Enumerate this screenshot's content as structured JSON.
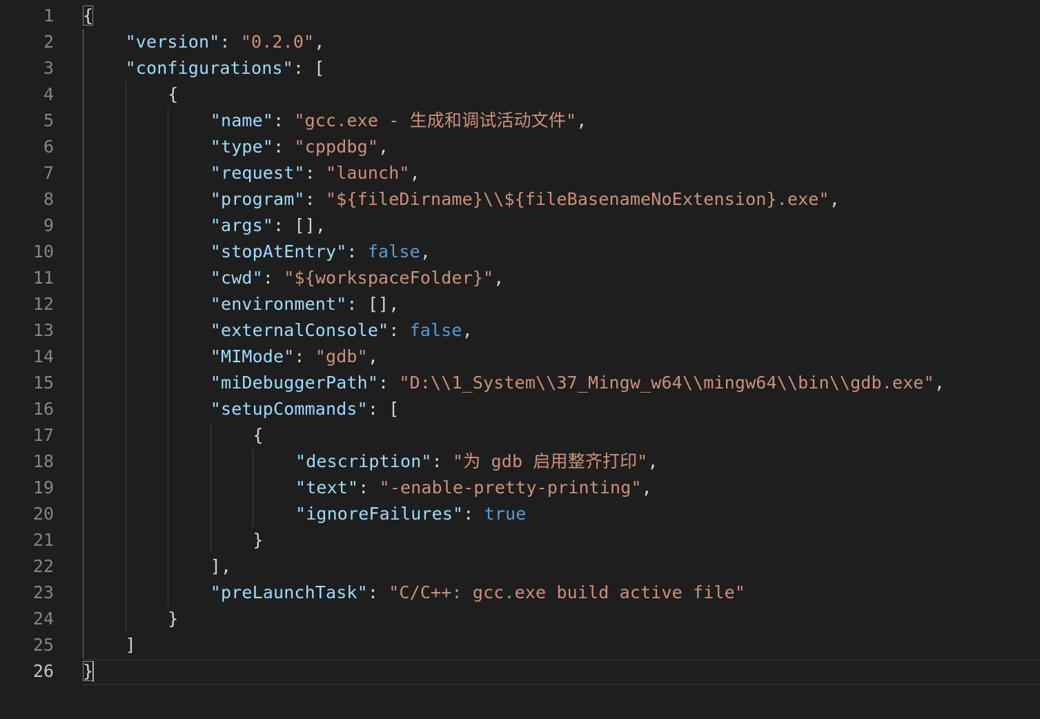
{
  "editor": {
    "active_line": 26,
    "theme": {
      "background": "#1e1e1e",
      "key_color": "#9cdcfe",
      "string_color": "#ce9178",
      "keyword_color": "#569cd6",
      "punctuation_color": "#d4d4d4",
      "line_number_color": "#858585"
    },
    "lines": [
      {
        "n": "1",
        "indent": 0,
        "tokens": [
          {
            "t": "pun",
            "v": "{"
          }
        ]
      },
      {
        "n": "2",
        "indent": 1,
        "tokens": [
          {
            "t": "key",
            "v": "\"version\""
          },
          {
            "t": "pun",
            "v": ": "
          },
          {
            "t": "str",
            "v": "\"0.2.0\""
          },
          {
            "t": "pun",
            "v": ","
          }
        ]
      },
      {
        "n": "3",
        "indent": 1,
        "tokens": [
          {
            "t": "key",
            "v": "\"configurations\""
          },
          {
            "t": "pun",
            "v": ": ["
          }
        ]
      },
      {
        "n": "4",
        "indent": 2,
        "tokens": [
          {
            "t": "pun",
            "v": "{"
          }
        ]
      },
      {
        "n": "5",
        "indent": 3,
        "tokens": [
          {
            "t": "key",
            "v": "\"name\""
          },
          {
            "t": "pun",
            "v": ": "
          },
          {
            "t": "str",
            "v": "\"gcc.exe - 生成和调试活动文件\""
          },
          {
            "t": "pun",
            "v": ","
          }
        ]
      },
      {
        "n": "6",
        "indent": 3,
        "tokens": [
          {
            "t": "key",
            "v": "\"type\""
          },
          {
            "t": "pun",
            "v": ": "
          },
          {
            "t": "str",
            "v": "\"cppdbg\""
          },
          {
            "t": "pun",
            "v": ","
          }
        ]
      },
      {
        "n": "7",
        "indent": 3,
        "tokens": [
          {
            "t": "key",
            "v": "\"request\""
          },
          {
            "t": "pun",
            "v": ": "
          },
          {
            "t": "str",
            "v": "\"launch\""
          },
          {
            "t": "pun",
            "v": ","
          }
        ]
      },
      {
        "n": "8",
        "indent": 3,
        "tokens": [
          {
            "t": "key",
            "v": "\"program\""
          },
          {
            "t": "pun",
            "v": ": "
          },
          {
            "t": "str",
            "v": "\"${fileDirname}\\\\${fileBasenameNoExtension}.exe\""
          },
          {
            "t": "pun",
            "v": ","
          }
        ]
      },
      {
        "n": "9",
        "indent": 3,
        "tokens": [
          {
            "t": "key",
            "v": "\"args\""
          },
          {
            "t": "pun",
            "v": ": [],"
          }
        ]
      },
      {
        "n": "10",
        "indent": 3,
        "tokens": [
          {
            "t": "key",
            "v": "\"stopAtEntry\""
          },
          {
            "t": "pun",
            "v": ": "
          },
          {
            "t": "kw",
            "v": "false"
          },
          {
            "t": "pun",
            "v": ","
          }
        ]
      },
      {
        "n": "11",
        "indent": 3,
        "tokens": [
          {
            "t": "key",
            "v": "\"cwd\""
          },
          {
            "t": "pun",
            "v": ": "
          },
          {
            "t": "str",
            "v": "\"${workspaceFolder}\""
          },
          {
            "t": "pun",
            "v": ","
          }
        ]
      },
      {
        "n": "12",
        "indent": 3,
        "tokens": [
          {
            "t": "key",
            "v": "\"environment\""
          },
          {
            "t": "pun",
            "v": ": [],"
          }
        ]
      },
      {
        "n": "13",
        "indent": 3,
        "tokens": [
          {
            "t": "key",
            "v": "\"externalConsole\""
          },
          {
            "t": "pun",
            "v": ": "
          },
          {
            "t": "kw",
            "v": "false"
          },
          {
            "t": "pun",
            "v": ","
          }
        ]
      },
      {
        "n": "14",
        "indent": 3,
        "tokens": [
          {
            "t": "key",
            "v": "\"MIMode\""
          },
          {
            "t": "pun",
            "v": ": "
          },
          {
            "t": "str",
            "v": "\"gdb\""
          },
          {
            "t": "pun",
            "v": ","
          }
        ]
      },
      {
        "n": "15",
        "indent": 3,
        "tokens": [
          {
            "t": "key",
            "v": "\"miDebuggerPath\""
          },
          {
            "t": "pun",
            "v": ": "
          },
          {
            "t": "str",
            "v": "\"D:\\\\1_System\\\\37_Mingw_w64\\\\mingw64\\\\bin\\\\gdb.exe\""
          },
          {
            "t": "pun",
            "v": ","
          }
        ]
      },
      {
        "n": "16",
        "indent": 3,
        "tokens": [
          {
            "t": "key",
            "v": "\"setupCommands\""
          },
          {
            "t": "pun",
            "v": ": ["
          }
        ]
      },
      {
        "n": "17",
        "indent": 4,
        "tokens": [
          {
            "t": "pun",
            "v": "{"
          }
        ]
      },
      {
        "n": "18",
        "indent": 5,
        "tokens": [
          {
            "t": "key",
            "v": "\"description\""
          },
          {
            "t": "pun",
            "v": ": "
          },
          {
            "t": "str",
            "v": "\"为 gdb 启用整齐打印\""
          },
          {
            "t": "pun",
            "v": ","
          }
        ]
      },
      {
        "n": "19",
        "indent": 5,
        "tokens": [
          {
            "t": "key",
            "v": "\"text\""
          },
          {
            "t": "pun",
            "v": ": "
          },
          {
            "t": "str",
            "v": "\"-enable-pretty-printing\""
          },
          {
            "t": "pun",
            "v": ","
          }
        ]
      },
      {
        "n": "20",
        "indent": 5,
        "tokens": [
          {
            "t": "key",
            "v": "\"ignoreFailures\""
          },
          {
            "t": "pun",
            "v": ": "
          },
          {
            "t": "kw",
            "v": "true"
          }
        ]
      },
      {
        "n": "21",
        "indent": 4,
        "tokens": [
          {
            "t": "pun",
            "v": "}"
          }
        ]
      },
      {
        "n": "22",
        "indent": 3,
        "tokens": [
          {
            "t": "pun",
            "v": "],"
          }
        ]
      },
      {
        "n": "23",
        "indent": 3,
        "tokens": [
          {
            "t": "key",
            "v": "\"preLaunchTask\""
          },
          {
            "t": "pun",
            "v": ": "
          },
          {
            "t": "str",
            "v": "\"C/C++: gcc.exe build active file\""
          }
        ]
      },
      {
        "n": "24",
        "indent": 2,
        "tokens": [
          {
            "t": "pun",
            "v": "}"
          }
        ]
      },
      {
        "n": "25",
        "indent": 1,
        "tokens": [
          {
            "t": "pun",
            "v": "]"
          }
        ]
      },
      {
        "n": "26",
        "indent": 0,
        "tokens": [
          {
            "t": "pun",
            "v": "}"
          }
        ]
      }
    ]
  }
}
